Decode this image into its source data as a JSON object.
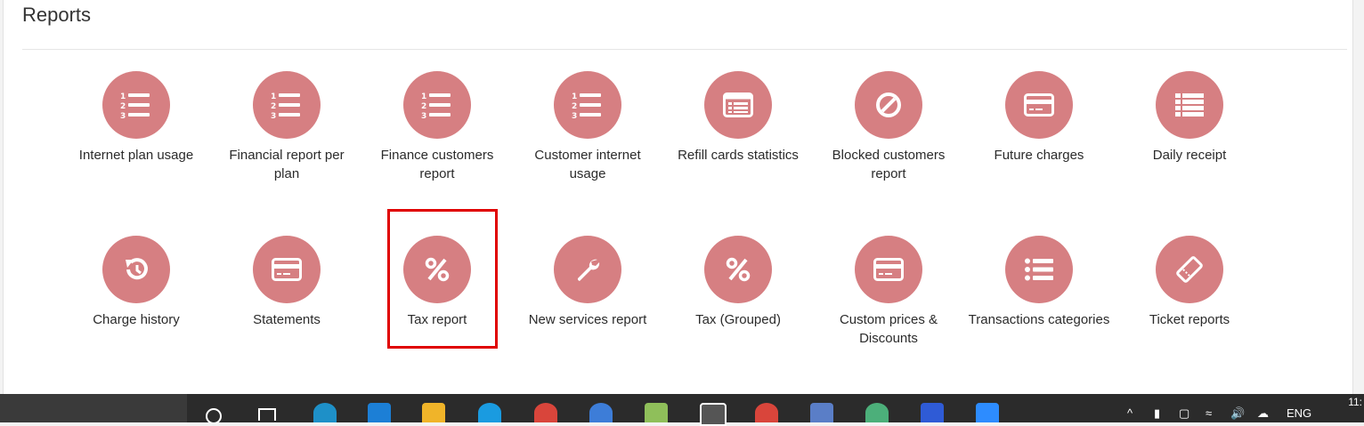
{
  "page": {
    "title": "Reports"
  },
  "reports_row1": [
    {
      "label": "Internet plan usage",
      "icon": "numbered-list-icon"
    },
    {
      "label": "Financial report per plan",
      "icon": "numbered-list-icon"
    },
    {
      "label": "Finance customers report",
      "icon": "numbered-list-icon"
    },
    {
      "label": "Customer internet usage",
      "icon": "numbered-list-icon"
    },
    {
      "label": "Refill cards statistics",
      "icon": "list-card-icon"
    },
    {
      "label": "Blocked customers report",
      "icon": "ban-icon"
    },
    {
      "label": "Future charges",
      "icon": "credit-card-icon"
    },
    {
      "label": "Daily receipt",
      "icon": "list-icon"
    }
  ],
  "reports_row2": [
    {
      "label": "Charge history",
      "icon": "history-icon"
    },
    {
      "label": "Statements",
      "icon": "credit-card-icon"
    },
    {
      "label": "Tax report",
      "icon": "percent-icon"
    },
    {
      "label": "New services report",
      "icon": "wrench-icon"
    },
    {
      "label": "Tax (Grouped)",
      "icon": "percent-icon"
    },
    {
      "label": "Custom prices & Discounts",
      "icon": "credit-card-icon"
    },
    {
      "label": "Transactions categories",
      "icon": "bullet-list-icon"
    },
    {
      "label": "Ticket reports",
      "icon": "ticket-icon"
    }
  ],
  "colors": {
    "icon_circle": "#d67f82",
    "highlight": "#e00000"
  },
  "taskbar": {
    "language": "ENG",
    "clock": "11:"
  }
}
